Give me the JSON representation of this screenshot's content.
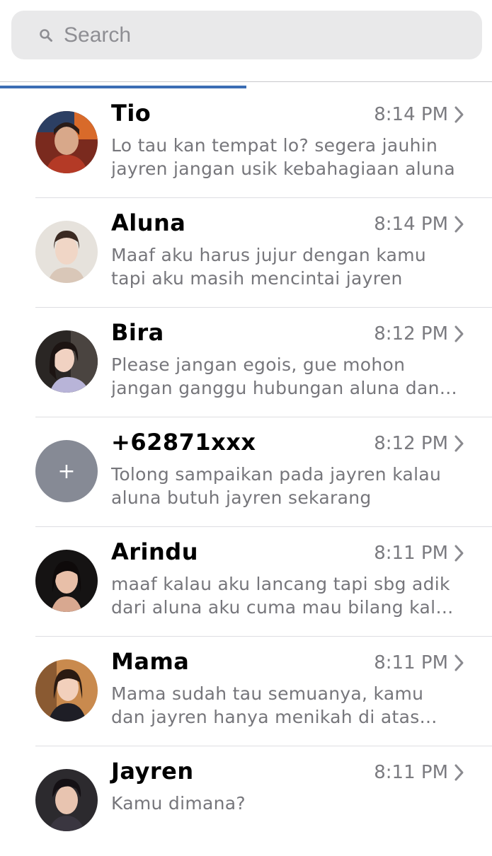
{
  "search": {
    "placeholder": "Search"
  },
  "conversations": [
    {
      "name": "Tio",
      "time": "8:14 PM",
      "message": "Lo tau kan tempat lo? segera jauhin jayren jangan usik kebahagiaan aluna"
    },
    {
      "name": "Aluna",
      "time": "8:14 PM",
      "message": "Maaf aku harus jujur dengan kamu tapi aku masih mencintai jayren"
    },
    {
      "name": "Bira",
      "time": "8:12 PM",
      "message": "Please jangan egois, gue mohon jangan ganggu hubungan aluna dan jayren"
    },
    {
      "name": "+62871xxx",
      "time": "8:12 PM",
      "message": "Tolong sampaikan pada jayren kalau aluna butuh jayren sekarang",
      "avatar_glyph": "+"
    },
    {
      "name": "Arindu",
      "time": "8:11 PM",
      "message": "maaf kalau aku lancang tapi sbg adik dari aluna aku cuma mau bilang kalo aluna jayren"
    },
    {
      "name": "Mama",
      "time": "8:11 PM",
      "message": "Mama sudah tau semuanya, kamu dan jayren hanya menikah di atas perjanjian"
    },
    {
      "name": "Jayren",
      "time": "8:11 PM",
      "message": "Kamu dimana?"
    }
  ],
  "colors": {
    "accent": "#3b6db4",
    "placeholder_avatar": "#868a95"
  }
}
